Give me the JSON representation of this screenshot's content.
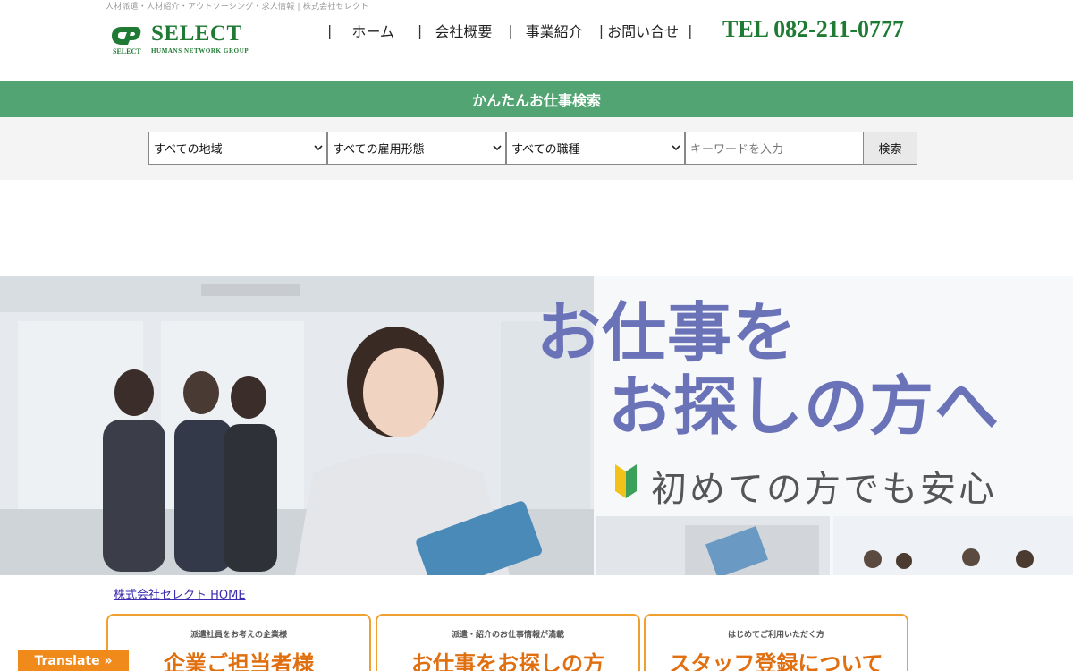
{
  "header": {
    "tagline": "人材派遣・人材紹介・アウトソーシング・求人情報 | 株式会社セレクト",
    "logo": {
      "word": "SELECT",
      "sub_left": "SELECT",
      "sub_right": "HUMANS NETWORK GROUP"
    },
    "nav": [
      {
        "label": "ホーム"
      },
      {
        "label": "会社概要"
      },
      {
        "label": "事業紹介"
      },
      {
        "label": "お問い合せ"
      }
    ],
    "separator": "|",
    "tel": "TEL 082-211-0777",
    "brand_color": "#1f7a33"
  },
  "search": {
    "title": "かんたんお仕事検索",
    "bar_color": "#52a572",
    "region_select": "すべての地域",
    "employment_select": "すべての雇用形態",
    "job_select": "すべての職種",
    "keyword_placeholder": "キーワードを入力",
    "button_label": "検索"
  },
  "hero": {
    "headline_1": "お仕事を",
    "headline_2": "お探しの方へ",
    "subline": "初めての方でも安心",
    "headline_color": "#6a72b8"
  },
  "breadcrumb": "株式会社セレクト HOME",
  "cards": [
    {
      "small": "派遣社員をお考えの企業様",
      "big": "企業ご担当者様"
    },
    {
      "small": "派遣・紹介のお仕事情報が満載",
      "big": "お仕事をお探しの方"
    },
    {
      "small": "はじめてご利用いただく方",
      "big": "スタッフ登録について"
    }
  ],
  "card_accent": "#f0a030",
  "translate_label": "Translate »"
}
